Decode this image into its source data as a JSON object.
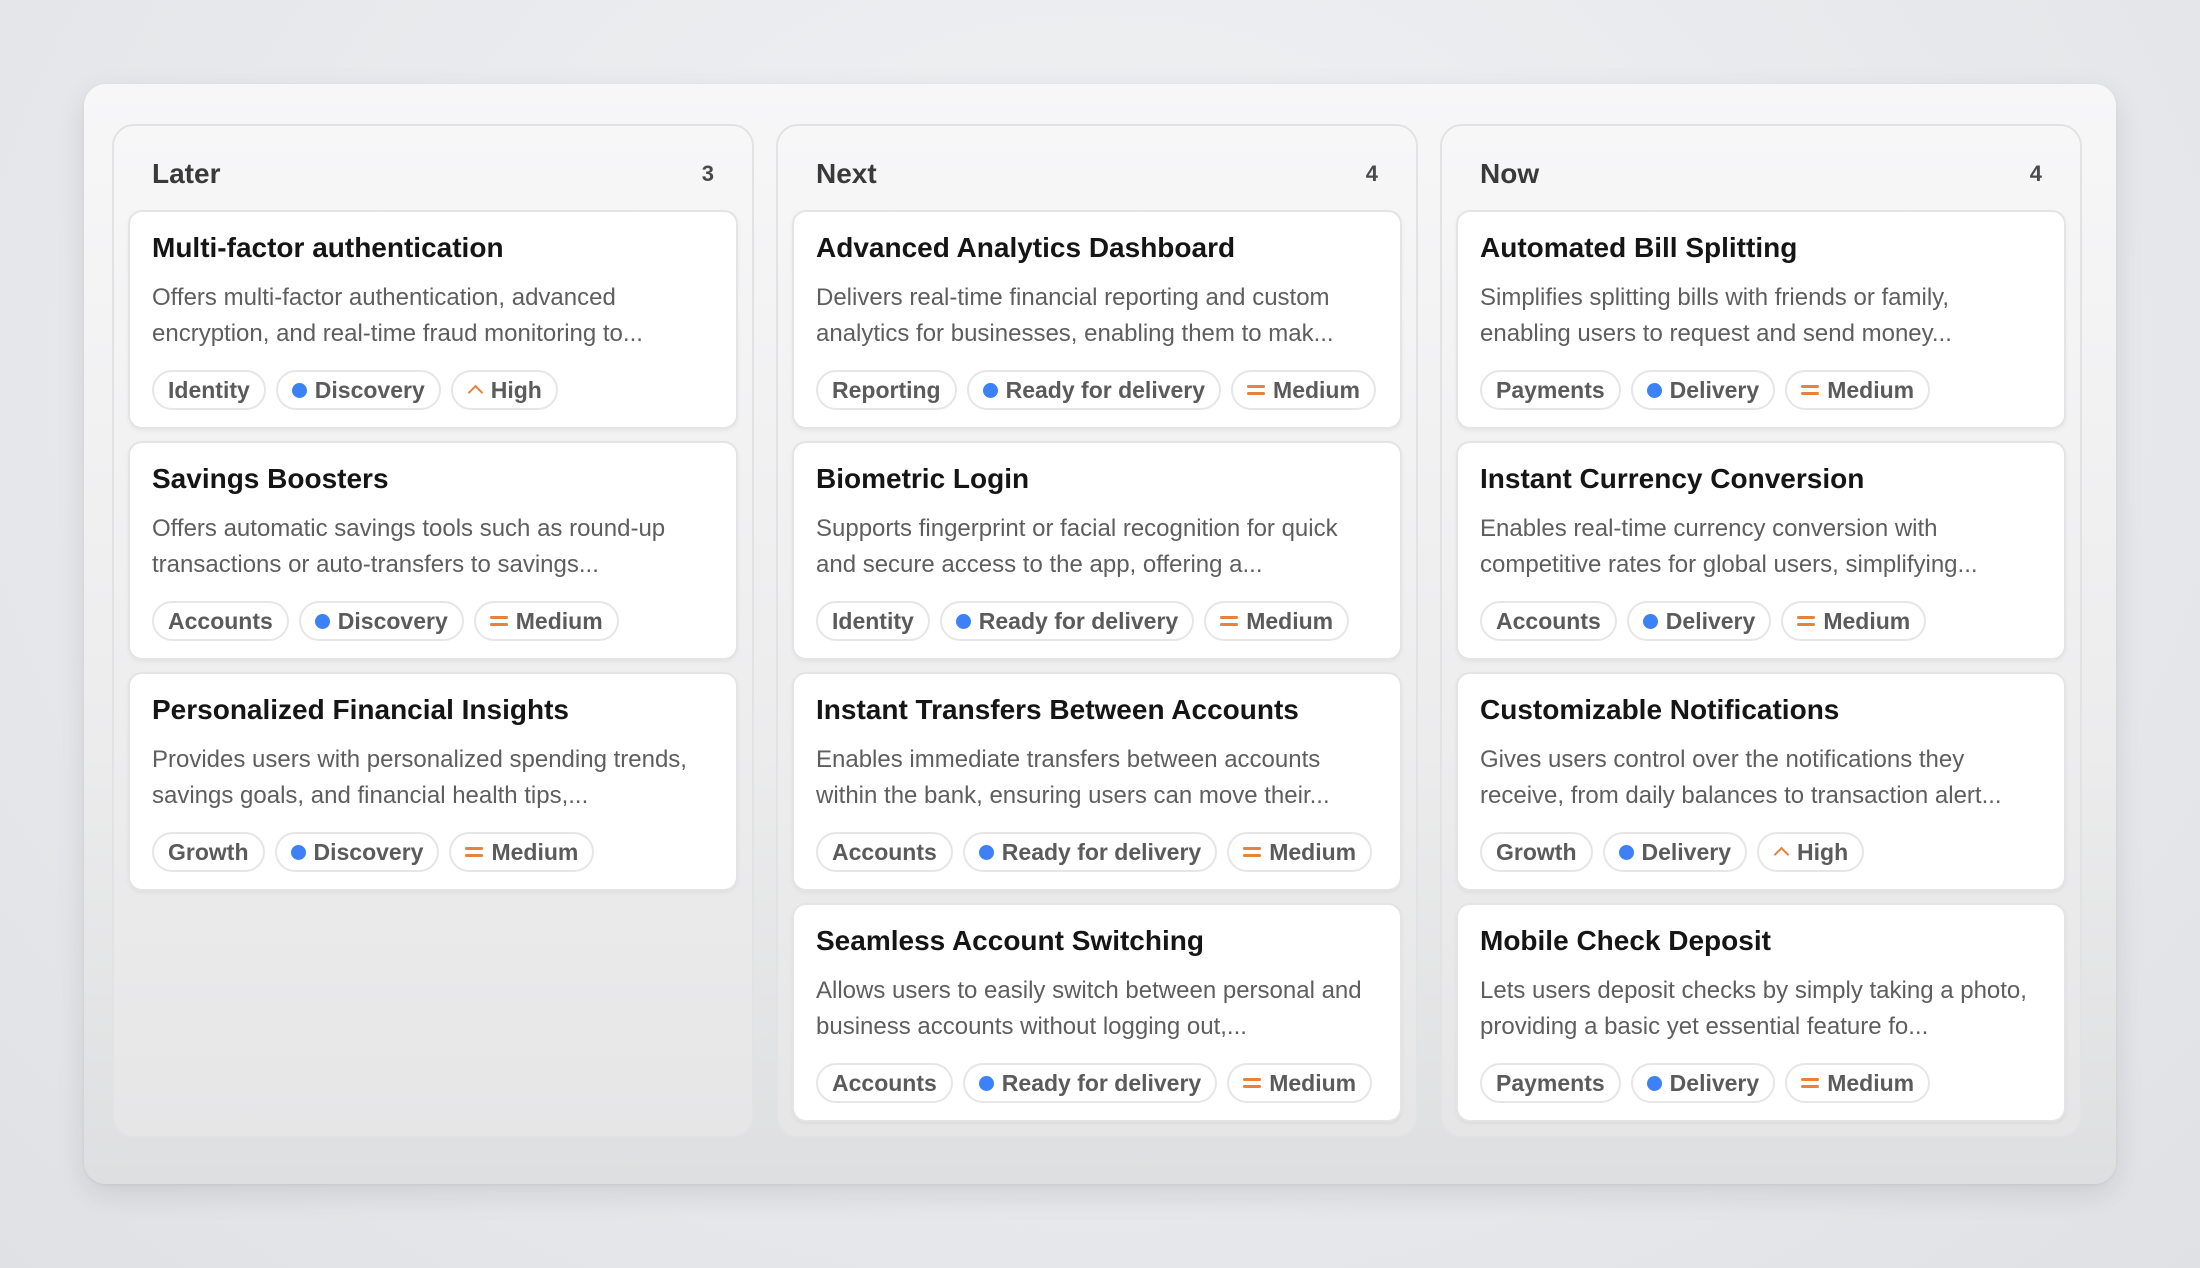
{
  "columns": [
    {
      "title": "Later",
      "count": "3",
      "cards": [
        {
          "title": "Multi-factor authentication",
          "desc": "Offers multi-factor authentication, advanced encryption, and real-time fraud monitoring to...",
          "tag": "Identity",
          "status": "Discovery",
          "priority": "High"
        },
        {
          "title": "Savings Boosters",
          "desc": "Offers automatic savings tools such as round-up transactions or auto-transfers to savings...",
          "tag": "Accounts",
          "status": "Discovery",
          "priority": "Medium"
        },
        {
          "title": "Personalized Financial Insights",
          "desc": "Provides users with personalized spending trends, savings goals, and financial health tips,...",
          "tag": "Growth",
          "status": "Discovery",
          "priority": "Medium"
        }
      ]
    },
    {
      "title": "Next",
      "count": "4",
      "cards": [
        {
          "title": "Advanced Analytics Dashboard",
          "desc": "Delivers real-time financial reporting and custom analytics for businesses, enabling them to mak...",
          "tag": "Reporting",
          "status": "Ready for delivery",
          "priority": "Medium"
        },
        {
          "title": "Biometric Login",
          "desc": "Supports fingerprint or facial recognition for quick and secure access to the app, offering a...",
          "tag": "Identity",
          "status": "Ready for delivery",
          "priority": "Medium"
        },
        {
          "title": "Instant Transfers Between Accounts",
          "desc": "Enables immediate transfers between accounts within the bank, ensuring users can move their...",
          "tag": "Accounts",
          "status": "Ready for delivery",
          "priority": "Medium"
        },
        {
          "title": "Seamless Account Switching",
          "desc": "Allows users to easily switch between personal and business accounts without logging out,...",
          "tag": "Accounts",
          "status": "Ready for delivery",
          "priority": "Medium"
        }
      ]
    },
    {
      "title": "Now",
      "count": "4",
      "cards": [
        {
          "title": "Automated Bill Splitting",
          "desc": "Simplifies splitting bills with friends or family, enabling users to request and send money...",
          "tag": "Payments",
          "status": "Delivery",
          "priority": "Medium"
        },
        {
          "title": "Instant Currency Conversion",
          "desc": "Enables real-time currency conversion with competitive rates for global users, simplifying...",
          "tag": "Accounts",
          "status": "Delivery",
          "priority": "Medium"
        },
        {
          "title": "Customizable Notifications",
          "desc": "Gives users control over the notifications they receive, from daily balances to transaction alert...",
          "tag": "Growth",
          "status": "Delivery",
          "priority": "High"
        },
        {
          "title": "Mobile Check Deposit",
          "desc": "Lets users deposit checks by simply taking a photo, providing a basic yet essential feature fo...",
          "tag": "Payments",
          "status": "Delivery",
          "priority": "Medium"
        }
      ]
    }
  ],
  "colors": {
    "status_dot": "#3c82f6",
    "priority_icon": "#e8823a"
  },
  "icons": {
    "status": "status-dot-icon",
    "priority_high": "chevron-up-icon",
    "priority_medium": "equals-icon"
  }
}
